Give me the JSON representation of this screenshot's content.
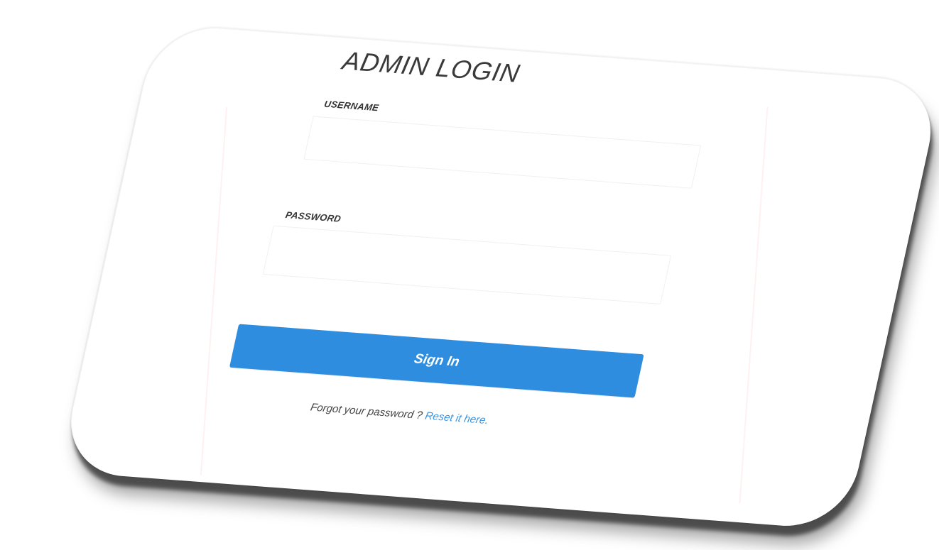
{
  "login": {
    "title": "ADMIN LOGIN",
    "username_label": "USERNAME",
    "username_value": "",
    "password_label": "PASSWORD",
    "password_value": "",
    "signin_label": "Sign In",
    "forgot_text": "Forgot your password ? ",
    "reset_link": "Reset it here."
  },
  "colors": {
    "button": "#2f8de0",
    "link": "#3a95e2",
    "text": "#3a3a3a",
    "background": "#ffffff"
  }
}
